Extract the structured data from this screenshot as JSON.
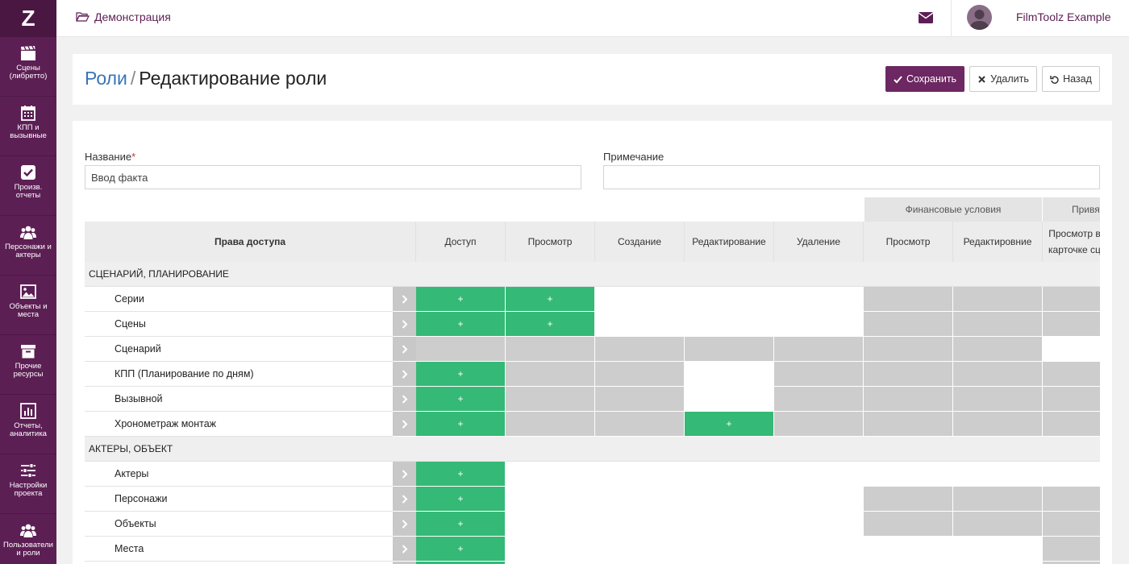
{
  "sidebar": {
    "logo": "Z",
    "items": [
      {
        "label": "Сцены (либретто)",
        "icon": "clapperboard-icon"
      },
      {
        "label": "КПП и вызывные",
        "icon": "calendar-icon"
      },
      {
        "label": "Произв. отчеты",
        "icon": "checkbox-icon"
      },
      {
        "label": "Персонажи и актеры",
        "icon": "users-icon"
      },
      {
        "label": "Объекты и места",
        "icon": "image-icon"
      },
      {
        "label": "Прочие ресурсы",
        "icon": "archive-icon"
      },
      {
        "label": "Отчеты, аналитика",
        "icon": "bar-chart-icon"
      },
      {
        "label": "Настройки проекта",
        "icon": "sliders-icon"
      },
      {
        "label": "Пользователи и роли",
        "icon": "users-icon"
      }
    ]
  },
  "topbar": {
    "project": "Демонстрация",
    "user": "FilmToolz Example"
  },
  "header": {
    "crumb": "Роли",
    "separator": "/",
    "title": "Редактирование роли",
    "save_label": "Сохранить",
    "delete_label": "Удалить",
    "back_label": "Назад"
  },
  "form": {
    "name_label": "Название",
    "name_required": "*",
    "name_value": "Ввод факта",
    "note_label": "Примечание",
    "note_value": ""
  },
  "table": {
    "group_headers": [
      "Финансовые условия",
      "Привя"
    ],
    "rights_header": "Права доступа",
    "columns": [
      "Доступ",
      "Просмотр",
      "Создание",
      "Редактирование",
      "Удаление",
      "Просмотр",
      "Редактировние",
      "Просмотр в карточке сц"
    ],
    "legend": {
      "full": "+",
      "partial": "-",
      "none": ""
    },
    "sections": [
      {
        "title": "СЦЕНАРИЙ, ПЛАНИРОВАНИЕ",
        "rows": [
          {
            "name": "Серии",
            "cells": [
              "full",
              "full",
              "partial",
              "partial",
              "partial",
              "none",
              "none",
              "none"
            ]
          },
          {
            "name": "Сцены",
            "cells": [
              "full",
              "full",
              "partial",
              "partial",
              "partial",
              "none",
              "none",
              "none"
            ]
          },
          {
            "name": "Сценарий",
            "cells": [
              "none",
              "none",
              "none",
              "none",
              "none",
              "none",
              "none",
              "partial"
            ]
          },
          {
            "name": "КПП (Планирование по дням)",
            "cells": [
              "full",
              "none",
              "none",
              "partial",
              "none",
              "none",
              "none",
              "none"
            ]
          },
          {
            "name": "Вызывной",
            "cells": [
              "full",
              "none",
              "none",
              "partial",
              "none",
              "none",
              "none",
              "none"
            ]
          },
          {
            "name": "Хронометраж монтаж",
            "cells": [
              "full",
              "none",
              "none",
              "full",
              "none",
              "none",
              "none",
              "none"
            ]
          }
        ]
      },
      {
        "title": "АКТЕРЫ, ОБЪЕКТ",
        "rows": [
          {
            "name": "Актеры",
            "cells": [
              "full",
              "partial",
              "partial",
              "partial",
              "partial",
              "partial",
              "partial",
              "partial"
            ]
          },
          {
            "name": "Персонажи",
            "cells": [
              "full",
              "partial",
              "partial",
              "partial",
              "partial",
              "none",
              "none",
              "none"
            ]
          },
          {
            "name": "Объекты",
            "cells": [
              "full",
              "partial",
              "partial",
              "partial",
              "partial",
              "none",
              "none",
              "none"
            ]
          },
          {
            "name": "Места",
            "cells": [
              "full",
              "partial",
              "partial",
              "partial",
              "partial",
              "partial",
              "partial",
              "none"
            ]
          },
          {
            "name": "",
            "cells": [
              "full",
              "partial",
              "partial",
              "partial",
              "partial",
              "partial",
              "partial",
              "none"
            ]
          }
        ]
      }
    ]
  },
  "colors": {
    "brand": "#5c1f54",
    "save_button": "#6d2762",
    "link": "#3a74b8",
    "full": "#35b977",
    "partial": "#97c8aa",
    "none": "#cdcdcd"
  }
}
